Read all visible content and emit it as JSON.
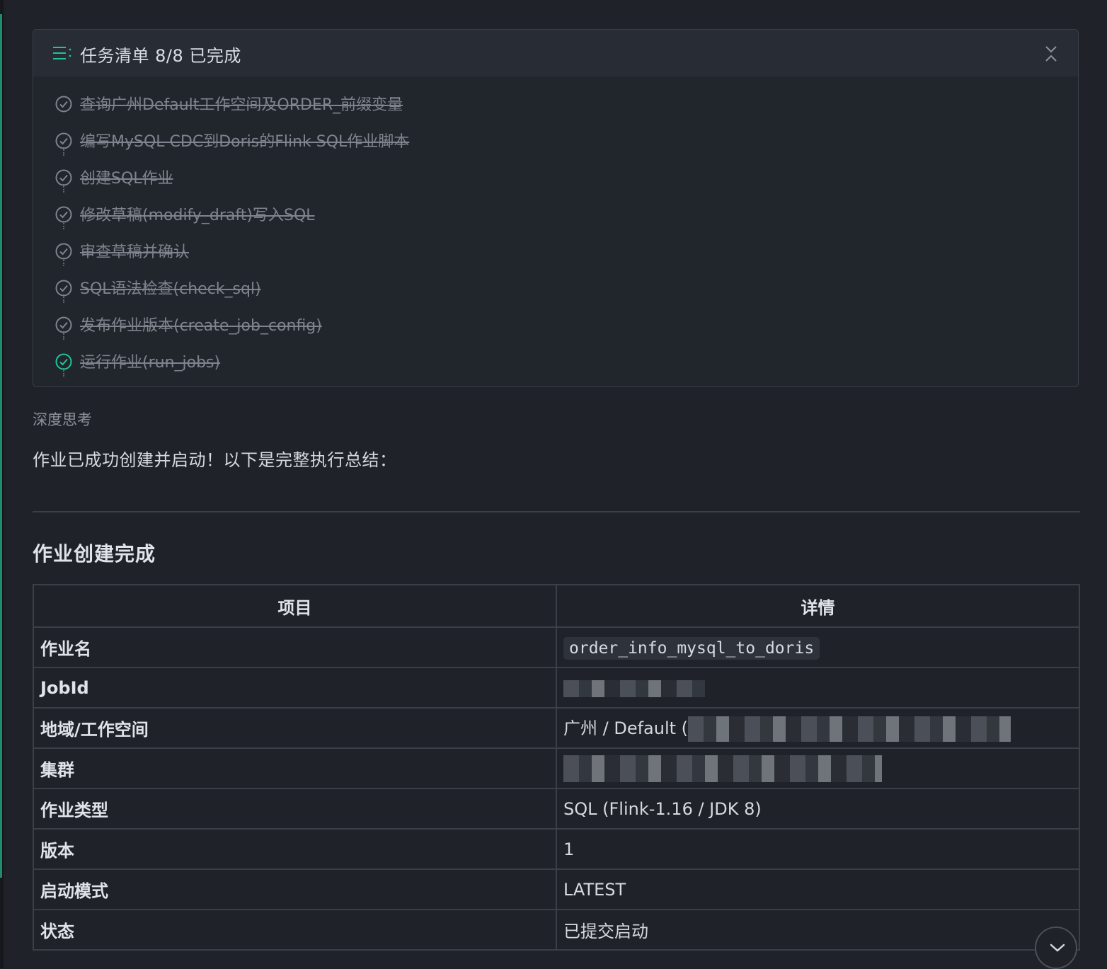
{
  "task_panel": {
    "title": "任务清单 8/8 已完成",
    "items": [
      {
        "label": "查询广州Default工作空间及ORDER_前缀变量"
      },
      {
        "label": "编写MySQL CDC到Doris的Flink SQL作业脚本"
      },
      {
        "label": "创建SQL作业"
      },
      {
        "label": "修改草稿(modify_draft)写入SQL"
      },
      {
        "label": "审查草稿并确认"
      },
      {
        "label": "SQL语法检查(check_sql)"
      },
      {
        "label": "发布作业版本(create_job_config)"
      },
      {
        "label": "运行作业(run_jobs)"
      }
    ],
    "accent_color": "#1fc497"
  },
  "thinking_label": "深度思考",
  "summary_text": "作业已成功创建并启动！以下是完整执行总结：",
  "section_title": "作业创建完成",
  "table": {
    "headers": [
      "项目",
      "详情"
    ],
    "rows": [
      {
        "key": "作业名",
        "value": "order_info_mysql_to_doris"
      },
      {
        "key": "JobId",
        "value": ""
      },
      {
        "key": "地域/工作空间",
        "value": "广州 / Default ("
      },
      {
        "key": "集群",
        "value": ""
      },
      {
        "key": "作业类型",
        "value": "SQL (Flink-1.16 / JDK 8)"
      },
      {
        "key": "版本",
        "value": "1"
      },
      {
        "key": "启动模式",
        "value": "LATEST"
      },
      {
        "key": "状态",
        "value": "已提交启动"
      }
    ]
  },
  "icons": {
    "task_list": "list-icon",
    "collapse": "collapse-icon",
    "check": "check-circle-icon",
    "scroll_down": "chevron-down-icon"
  }
}
